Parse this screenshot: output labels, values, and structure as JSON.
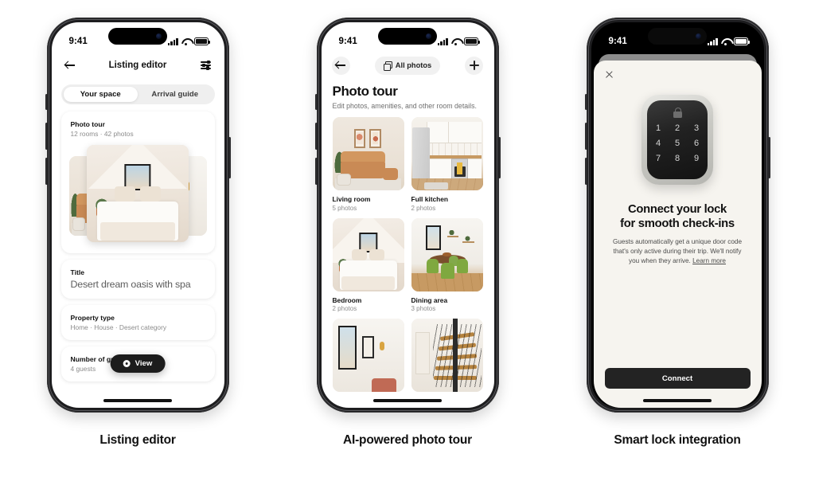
{
  "phones": [
    {
      "caption": "Listing editor",
      "status_bar": {
        "time": "9:41",
        "icons": [
          "cellular-signal-icon",
          "wifi-icon",
          "battery-icon"
        ]
      },
      "nav": {
        "back_icon": "back-arrow-icon",
        "title": "Listing editor",
        "right_icon": "sliders-icon"
      },
      "segmented": {
        "options": [
          "Your space",
          "Arrival guide"
        ],
        "selected": "Your space"
      },
      "cards": [
        {
          "kicker": "Photo tour",
          "sub": "12 rooms · 42 photos",
          "photos": [
            {
              "name": "bedroom-plant-photo"
            },
            {
              "name": "bedroom-hero-photo"
            },
            {
              "name": "shelf-photo"
            }
          ]
        },
        {
          "kicker": "Title",
          "value": "Desert dream oasis with spa"
        },
        {
          "kicker": "Property type",
          "value": "Home · House · Desert category"
        },
        {
          "kicker": "Number of guests",
          "value": "4 guests"
        }
      ],
      "view_pill": {
        "icon": "eye-icon",
        "label": "View"
      }
    },
    {
      "caption": "AI-powered photo tour",
      "status_bar": {
        "time": "9:41"
      },
      "nav": {
        "back_icon": "back-arrow-icon",
        "all_photos_label": "All photos",
        "all_photos_icon": "copy-layers-icon",
        "add_icon": "plus-icon"
      },
      "header": {
        "title": "Photo tour",
        "subtitle": "Edit photos, amenities, and other room details."
      },
      "rooms": [
        {
          "name": "Living room",
          "count": "5 photos",
          "scene": "livroom"
        },
        {
          "name": "Full kitchen",
          "count": "2 photos",
          "scene": "kitchen"
        },
        {
          "name": "Bedroom",
          "count": "2 photos",
          "scene": "bedroom"
        },
        {
          "name": "Dining area",
          "count": "3 photos",
          "scene": "dining"
        },
        {
          "name": "",
          "count": "",
          "scene": "hall"
        },
        {
          "name": "",
          "count": "",
          "scene": "stair"
        }
      ]
    },
    {
      "caption": "Smart lock integration",
      "status_bar": {
        "time": "9:41"
      },
      "close_icon": "close-x-icon",
      "device": {
        "name": "smart-lock-keypad",
        "lock_icon": "lock-icon",
        "keys": [
          "1",
          "2",
          "3",
          "4",
          "5",
          "6",
          "7",
          "8",
          "9"
        ]
      },
      "headline_line1": "Connect your lock",
      "headline_line2": "for smooth check-ins",
      "body": "Guests automatically get a unique door code that's only active during their trip. We'll notify you when they arrive. ",
      "body_link": "Learn more",
      "cta": "Connect"
    }
  ],
  "colors": {
    "page_bg": "#ffffff",
    "phone_frame": "#1d1d1f",
    "sheet_bg": "#f6f4ef",
    "dark_button": "#232323",
    "muted_text": "#8c8c8c"
  }
}
